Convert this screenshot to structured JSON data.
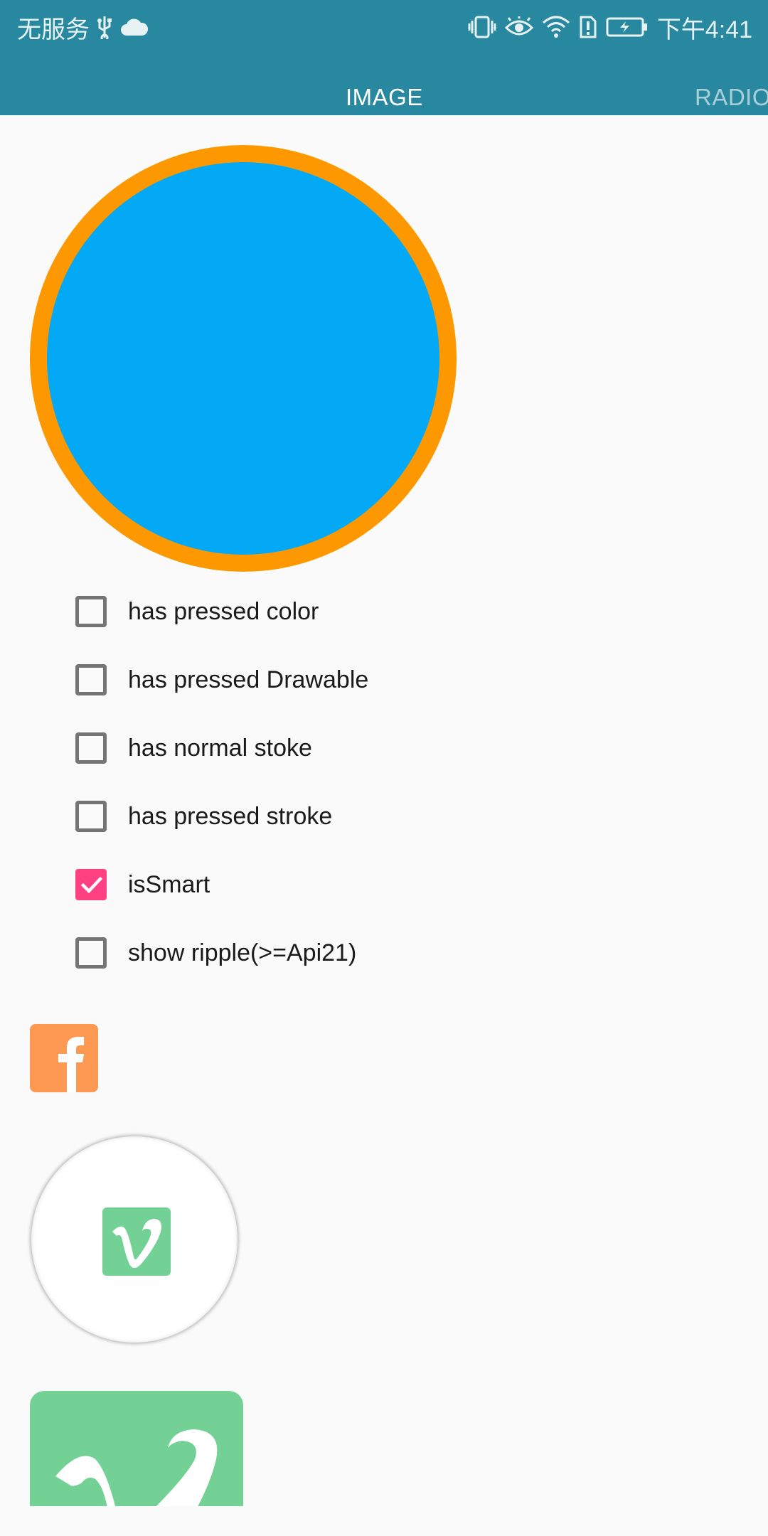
{
  "status_bar": {
    "carrier": "无服务",
    "time": "下午4:41",
    "icons": [
      "usb-icon",
      "cloud-icon",
      "vibrate-icon",
      "eye-icon",
      "wifi-icon",
      "sim-alert-icon",
      "battery-charging-icon"
    ]
  },
  "tabs": [
    {
      "label": "IMAGE",
      "selected": true
    },
    {
      "label": "RADIO",
      "selected": false
    }
  ],
  "preview": {
    "stroke_color": "#fe9800",
    "fill_color": "#03a9f4"
  },
  "options": [
    {
      "label": "has pressed color",
      "checked": false
    },
    {
      "label": "has pressed Drawable",
      "checked": false
    },
    {
      "label": "has normal stoke",
      "checked": false
    },
    {
      "label": "has pressed stroke",
      "checked": false
    },
    {
      "label": "isSmart",
      "checked": true
    },
    {
      "label": "show ripple(>=Api21)",
      "checked": false
    }
  ],
  "icons": {
    "facebook": {
      "name": "facebook-icon",
      "color": "#fd9952"
    },
    "vimeo": {
      "name": "vimeo-icon",
      "color": "#73d195"
    }
  },
  "colors": {
    "toolbar": "#28889f",
    "accent": "#ff4081"
  }
}
